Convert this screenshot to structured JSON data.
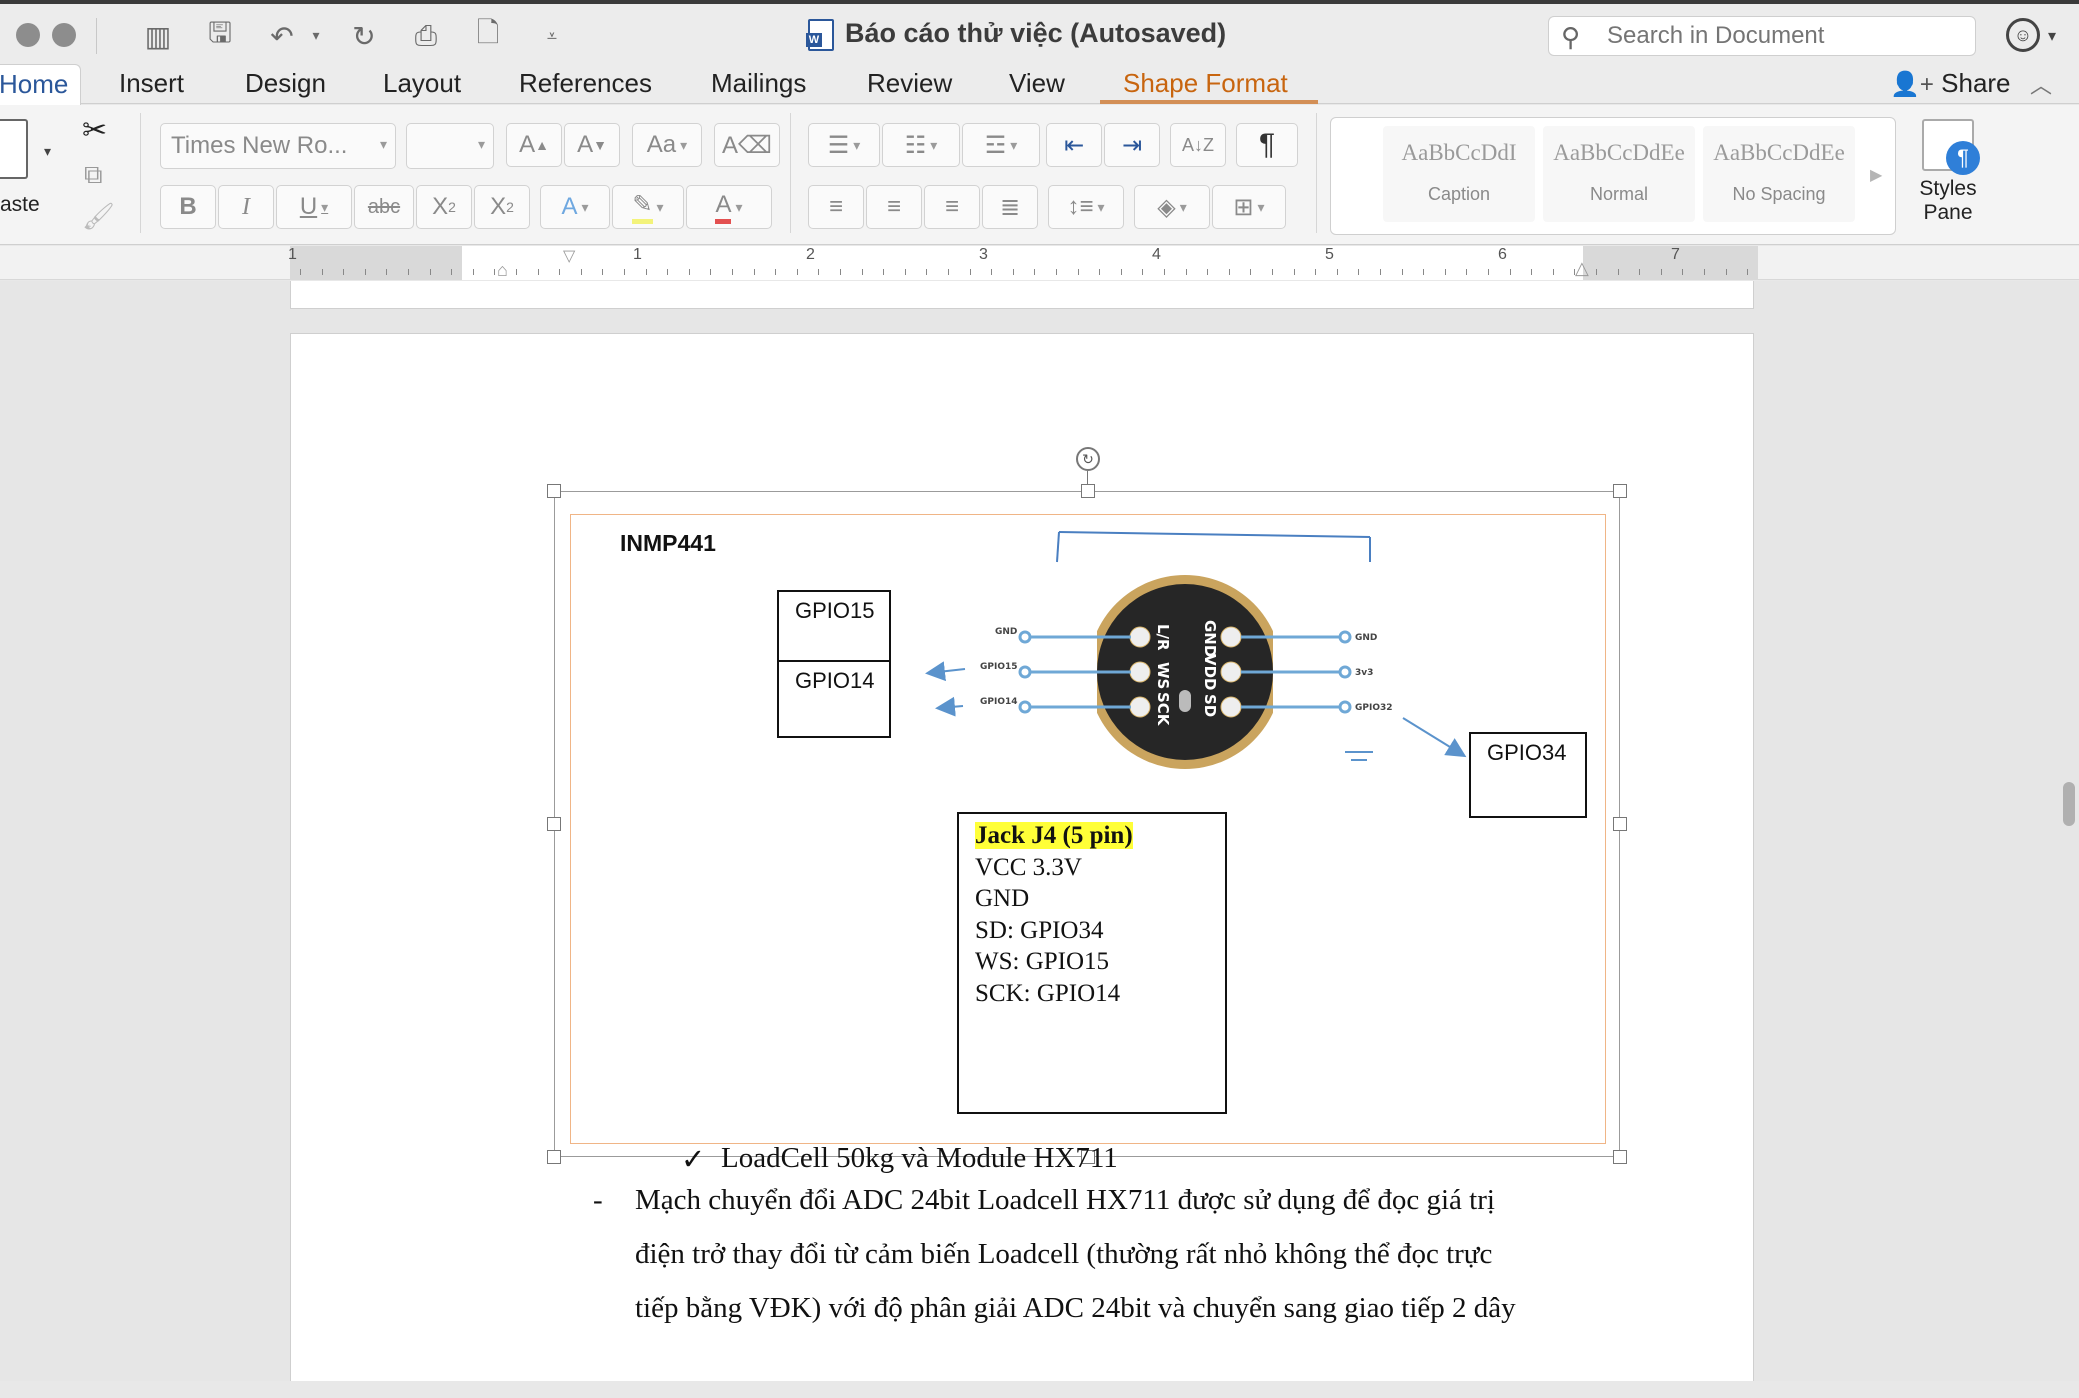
{
  "window": {
    "title": "Báo cáo thử việc (Autosaved)"
  },
  "search": {
    "placeholder": "Search in Document"
  },
  "tabs": [
    {
      "label": "Home"
    },
    {
      "label": "Insert"
    },
    {
      "label": "Design"
    },
    {
      "label": "Layout"
    },
    {
      "label": "References"
    },
    {
      "label": "Mailings"
    },
    {
      "label": "Review"
    },
    {
      "label": "View"
    },
    {
      "label": "Shape Format"
    }
  ],
  "share": {
    "label": "Share"
  },
  "ribbon": {
    "paste_label": "aste",
    "font_name": "Times New Ro...",
    "styles": [
      {
        "sample": "AaBbCcDdI",
        "name": "Caption"
      },
      {
        "sample": "AaBbCcDdEe",
        "name": "Normal"
      },
      {
        "sample": "AaBbCcDdEe",
        "name": "No Spacing"
      }
    ],
    "styles_pane": {
      "line1": "Styles",
      "line2": "Pane"
    }
  },
  "ruler": {
    "numbers": [
      "1",
      "1",
      "2",
      "3",
      "4",
      "5",
      "6",
      "7"
    ]
  },
  "diagram": {
    "title": "INMP441",
    "gpio15": "GPIO15",
    "gpio14": "GPIO14",
    "gpio34": "GPIO34",
    "jack": {
      "title": "Jack J4 (5 pin)",
      "lines": [
        "VCC 3.3V",
        "GND",
        "SD: GPIO34",
        "WS: GPIO15",
        "SCK: GPIO14"
      ]
    },
    "pin_labels_left": [
      "GND",
      "GPIO15",
      "GPIO14"
    ],
    "pin_labels_right": [
      "GND",
      "3v3",
      "GPIO32"
    ],
    "chip_left_col": [
      "L/R",
      "WS",
      "SCK"
    ],
    "chip_right_col": [
      "GND",
      "VDD",
      "SD"
    ]
  },
  "body": {
    "check_mark": "✓",
    "heading": "LoadCell 50kg và Module HX711",
    "bullet": "-",
    "para_lines": [
      "Mạch chuyển đổi ADC 24bit Loadcell HX711 được sử dụng để đọc giá trị",
      "điện trở thay đổi từ cảm biến Loadcell (thường rất nhỏ không thể đọc trực",
      "tiếp bằng VĐK) với độ phân giải ADC 24bit và chuyển sang giao tiếp 2 dây"
    ]
  },
  "colors": {
    "accent_tab": "#c8650f",
    "word_blue": "#2b579a",
    "highlight": "#ffff38",
    "frame_orange": "#f0b586"
  }
}
